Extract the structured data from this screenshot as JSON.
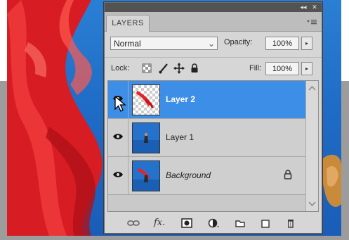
{
  "panel": {
    "title_controls": {
      "collapse": "◂◂",
      "close": "✕"
    },
    "tab_label": "LAYERS",
    "menu_icon": "panel-menu-icon",
    "blend_mode": "Normal",
    "opacity_label": "Opacity:",
    "opacity_value": "100%",
    "lock_label": "Lock:",
    "lock_icons": [
      "lock-transparent-icon",
      "lock-paint-icon",
      "lock-move-icon",
      "lock-all-icon"
    ],
    "fill_label": "Fill:",
    "fill_value": "100%"
  },
  "layers": [
    {
      "name": "Layer 2",
      "selected": true,
      "visible": true
    },
    {
      "name": "Layer 1",
      "selected": false,
      "visible": true
    },
    {
      "name": "Background",
      "selected": false,
      "visible": true,
      "locked": true
    }
  ],
  "footer_icons": [
    "link-layers-icon",
    "fx-icon",
    "mask-icon",
    "adjustment-icon",
    "group-icon",
    "new-layer-icon",
    "trash-icon"
  ],
  "footer_fx_text": "fx.",
  "colors": {
    "selection": "#3d8ee6",
    "panel": "#d6d6d6",
    "sky": "#2a7fd4",
    "fabric_red": "#e8222a"
  }
}
